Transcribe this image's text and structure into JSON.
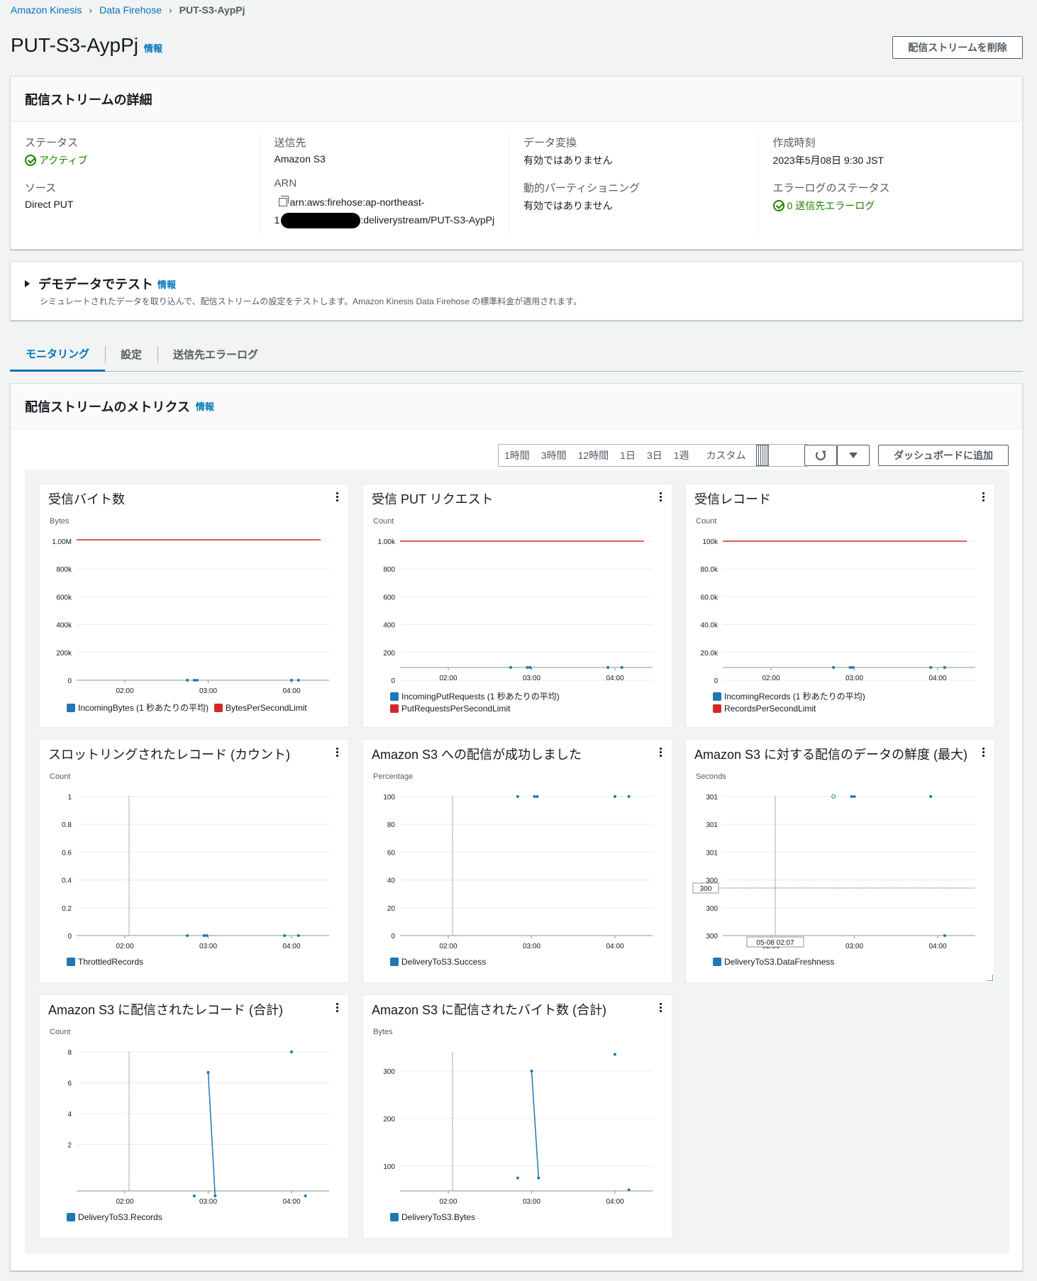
{
  "breadcrumb": {
    "item1": "Amazon Kinesis",
    "item2": "Data Firehose",
    "current": "PUT-S3-AypPj"
  },
  "header": {
    "title": "PUT-S3-AypPj",
    "info": "情報",
    "delete_button": "配信ストリームを削除"
  },
  "details": {
    "title": "配信ストリームの詳細",
    "status_label": "ステータス",
    "status_value": "アクティブ",
    "source_label": "ソース",
    "source_value": "Direct PUT",
    "destination_label": "送信先",
    "destination_value": "Amazon S3",
    "arn_label": "ARN",
    "arn_line1": "arn:aws:firehose:ap-northeast-",
    "arn_line2_prefix": "1",
    "arn_line2_suffix": ":deliverystream/PUT-S3-AypPj",
    "transform_label": "データ変換",
    "transform_value": "有効ではありません",
    "partition_label": "動的パーティショニング",
    "partition_value": "有効ではありません",
    "created_label": "作成時刻",
    "created_value": "2023年5月08日 9:30 JST",
    "errorlog_label": "エラーログのステータス",
    "errorlog_value": "0 送信先エラーログ"
  },
  "demo": {
    "title": "デモデータでテスト",
    "info": "情報",
    "description": "シミュレートされたデータを取り込んで、配信ストリームの設定をテストします。Amazon Kinesis Data Firehose の標準料金が適用されます。"
  },
  "tabs": [
    "モニタリング",
    "設定",
    "送信先エラーログ"
  ],
  "metrics": {
    "title": "配信ストリームのメトリクス",
    "info": "情報",
    "ranges": [
      "1時間",
      "3時間",
      "12時間",
      "1日",
      "3日",
      "1週",
      "カスタム"
    ],
    "add_dashboard": "ダッシュボードに追加"
  },
  "colors": {
    "series_blue": "#1f77b4",
    "limit_red": "#d62728",
    "link": "#0073bb",
    "success": "#1d8102"
  },
  "x_ticks": [
    "02:00",
    "03:00",
    "04:00"
  ],
  "widgets": [
    {
      "title": "受信バイト数",
      "unit": "Bytes",
      "yticks": [
        "1.00M",
        "800k",
        "600k",
        "400k",
        "200k",
        "0"
      ],
      "legend": [
        "IncomingBytes (1 秒あたりの平均)",
        "BytesPerSecondLimit"
      ]
    },
    {
      "title": "受信 PUT リクエスト",
      "unit": "Count",
      "yticks": [
        "1.00k",
        "800",
        "600",
        "400",
        "200",
        "0"
      ],
      "legend": [
        "IncomingPutRequests (1 秒あたりの平均)",
        "PutRequestsPerSecondLimit"
      ]
    },
    {
      "title": "受信レコード",
      "unit": "Count",
      "yticks": [
        "100k",
        "80.0k",
        "60.0k",
        "40.0k",
        "20.0k",
        "0"
      ],
      "legend": [
        "IncomingRecords (1 秒あたりの平均)",
        "RecordsPerSecondLimit"
      ]
    },
    {
      "title": "スロットリングされたレコード (カウント)",
      "unit": "Count",
      "yticks": [
        "1",
        "0.8",
        "0.6",
        "0.4",
        "0.2",
        "0"
      ],
      "legend": [
        "ThrottledRecords"
      ]
    },
    {
      "title": "Amazon S3 への配信が成功しました",
      "unit": "Percentage",
      "yticks": [
        "100",
        "80",
        "60",
        "40",
        "20",
        "0"
      ],
      "legend": [
        "DeliveryToS3.Success"
      ]
    },
    {
      "title": "Amazon S3 に対する配信のデータの鮮度 (最大)",
      "unit": "Seconds",
      "yticks": [
        "301",
        "301",
        "301",
        "300",
        "300",
        "300"
      ],
      "legend": [
        "DeliveryToS3.DataFreshness"
      ],
      "hover_y": "300",
      "hover_x": "05-08 02:07"
    },
    {
      "title": "Amazon S3 に配信されたレコード (合計)",
      "unit": "Count",
      "yticks": [
        "8",
        "6",
        "4",
        "2"
      ],
      "legend": [
        "DeliveryToS3.Records"
      ]
    },
    {
      "title": "Amazon S3 に配信されたバイト数 (合計)",
      "unit": "Bytes",
      "yticks": [
        "300",
        "200",
        "100"
      ],
      "legend": [
        "DeliveryToS3.Bytes"
      ]
    }
  ],
  "chart_data": [
    {
      "type": "line",
      "title": "受信バイト数",
      "ylabel": "Bytes",
      "x": [
        "02:45",
        "02:50",
        "02:52",
        "04:00",
        "04:05"
      ],
      "series": [
        {
          "name": "IncomingBytes (1 秒あたりの平均)",
          "values": [
            0,
            0,
            0,
            0,
            0
          ]
        },
        {
          "name": "BytesPerSecondLimit",
          "values": [
            1050000,
            1050000,
            1050000,
            1050000,
            1050000
          ]
        }
      ],
      "ylim": [
        0,
        1000000
      ]
    },
    {
      "type": "line",
      "title": "受信 PUT リクエスト",
      "ylabel": "Count",
      "x": [
        "02:45",
        "02:57",
        "02:59",
        "03:55",
        "04:05"
      ],
      "series": [
        {
          "name": "IncomingPutRequests (1 秒あたりの平均)",
          "values": [
            0,
            0,
            0,
            0,
            0
          ]
        },
        {
          "name": "PutRequestsPerSecondLimit",
          "values": [
            1000,
            1000,
            1000,
            1000,
            1000
          ]
        }
      ],
      "ylim": [
        0,
        1000
      ]
    },
    {
      "type": "line",
      "title": "受信レコード",
      "ylabel": "Count",
      "x": [
        "02:45",
        "02:57",
        "02:59",
        "03:55",
        "04:05"
      ],
      "series": [
        {
          "name": "IncomingRecords (1 秒あたりの平均)",
          "values": [
            0,
            0,
            0,
            0,
            0
          ]
        },
        {
          "name": "RecordsPerSecondLimit",
          "values": [
            100000,
            100000,
            100000,
            100000,
            100000
          ]
        }
      ],
      "ylim": [
        0,
        100000
      ]
    },
    {
      "type": "line",
      "title": "スロットリングされたレコード (カウント)",
      "ylabel": "Count",
      "x": [
        "02:45",
        "02:57",
        "02:59",
        "03:55",
        "04:05"
      ],
      "series": [
        {
          "name": "ThrottledRecords",
          "values": [
            0,
            0,
            0,
            0,
            0
          ]
        }
      ],
      "ylim": [
        0,
        1
      ]
    },
    {
      "type": "line",
      "title": "Amazon S3 への配信が成功しました",
      "ylabel": "Percentage",
      "x": [
        "02:50",
        "03:02",
        "03:04",
        "03:60",
        "04:10"
      ],
      "series": [
        {
          "name": "DeliveryToS3.Success",
          "values": [
            100,
            100,
            100,
            100,
            100
          ]
        }
      ],
      "ylim": [
        0,
        100
      ]
    },
    {
      "type": "line",
      "title": "Amazon S3 に対する配信のデータの鮮度 (最大)",
      "ylabel": "Seconds",
      "x": [
        "02:45",
        "02:58",
        "03:00",
        "03:55",
        "04:05"
      ],
      "series": [
        {
          "name": "DeliveryToS3.DataFreshness",
          "values": [
            301,
            301,
            301,
            301,
            300
          ]
        }
      ]
    },
    {
      "type": "line",
      "title": "Amazon S3 に配信されたレコード (合計)",
      "ylabel": "Count",
      "x": [
        "02:50",
        "03:00",
        "03:05",
        "04:00",
        "04:10"
      ],
      "series": [
        {
          "name": "DeliveryToS3.Records",
          "values": [
            1,
            7,
            1,
            8,
            1
          ]
        }
      ]
    },
    {
      "type": "line",
      "title": "Amazon S3 に配信されたバイト数 (合計)",
      "ylabel": "Bytes",
      "x": [
        "02:50",
        "03:00",
        "03:05",
        "03:60",
        "04:10"
      ],
      "series": [
        {
          "name": "DeliveryToS3.Bytes",
          "values": [
            75,
            300,
            75,
            335,
            50
          ]
        }
      ]
    }
  ]
}
